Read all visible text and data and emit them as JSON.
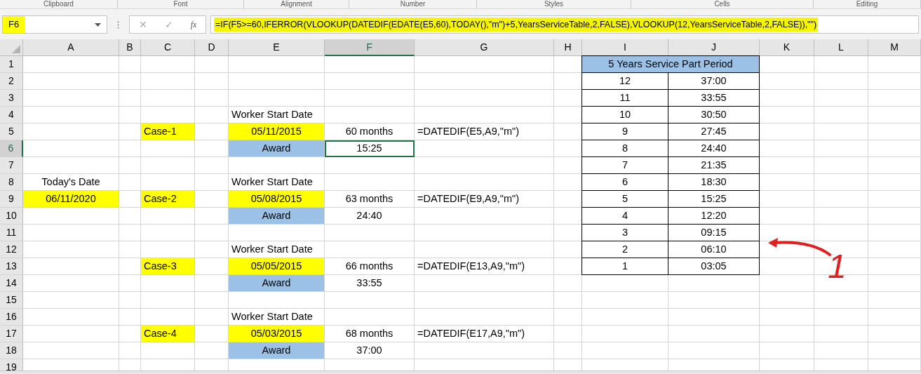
{
  "ribbon_groups": [
    "Clipboard",
    "Font",
    "Alignment",
    "Number",
    "Styles",
    "Cells",
    "Editing"
  ],
  "formula_bar": {
    "name_box": "F6",
    "cancel": "✕",
    "enter": "✓",
    "function": "fx",
    "formula": "=IF(F5>=60,IFERROR(VLOOKUP(DATEDIF(EDATE(E5,60),TODAY(),\"m\")+5,YearsServiceTable,2,FALSE),VLOOKUP(12,YearsServiceTable,2,FALSE)),\"\")"
  },
  "columns": [
    "A",
    "B",
    "C",
    "D",
    "E",
    "F",
    "G",
    "H",
    "I",
    "J",
    "K",
    "L",
    "M"
  ],
  "rows": [
    {
      "number": "1",
      "cells": {
        "I": {
          "text": "5 Years Service Part Period",
          "color": "#9bc2e6",
          "merge": true,
          "bordered": true,
          "selected": false
        }
      }
    },
    {
      "number": "2",
      "cells": {
        "I": {
          "text": "12",
          "bordered": true,
          "selected": false
        },
        "J": {
          "text": "37:00",
          "bordered": true,
          "selected": false
        }
      }
    },
    {
      "number": "3",
      "cells": {
        "I": {
          "text": "11",
          "bordered": true,
          "selected": false
        },
        "J": {
          "text": "33:55",
          "bordered": true,
          "selected": false
        }
      }
    },
    {
      "number": "4",
      "cells": {
        "E": {
          "text": "Worker Start Date",
          "left_aligned": true,
          "selected": false
        },
        "I": {
          "text": "10",
          "bordered": true,
          "selected": false
        },
        "J": {
          "text": "30:50",
          "bordered": true,
          "selected": false
        }
      }
    },
    {
      "number": "5",
      "cells": {
        "C": {
          "text": "Case-1",
          "color": "#ffff00",
          "left_aligned": true,
          "selected": false
        },
        "E": {
          "text": "05/11/2015",
          "color": "#ffff00",
          "selected": false
        },
        "F": {
          "text": "60 months",
          "selected": false
        },
        "G": {
          "text": "=DATEDIF(E5,A9,\"m\")",
          "left_aligned": true,
          "selected": false
        },
        "I": {
          "text": "9",
          "bordered": true,
          "selected": false
        },
        "J": {
          "text": "27:45",
          "bordered": true,
          "selected": false
        }
      }
    },
    {
      "number": "6",
      "cells": {
        "E": {
          "text": "Award",
          "color": "#9bc2e6",
          "selected": false
        },
        "F": {
          "text": "15:25",
          "selected": true
        },
        "I": {
          "text": "8",
          "bordered": true,
          "selected": false
        },
        "J": {
          "text": "24:40",
          "bordered": true,
          "selected": false
        }
      }
    },
    {
      "number": "7",
      "cells": {
        "I": {
          "text": "7",
          "bordered": true,
          "selected": false
        },
        "J": {
          "text": "21:35",
          "bordered": true,
          "selected": false
        }
      }
    },
    {
      "number": "8",
      "cells": {
        "A": {
          "text": "Today's Date",
          "selected": false
        },
        "E": {
          "text": "Worker Start Date",
          "left_aligned": true,
          "selected": false
        },
        "I": {
          "text": "6",
          "bordered": true,
          "selected": false
        },
        "J": {
          "text": "18:30",
          "bordered": true,
          "selected": false
        }
      }
    },
    {
      "number": "9",
      "cells": {
        "A": {
          "text": "06/11/2020",
          "color": "#ffff00",
          "selected": false
        },
        "C": {
          "text": "Case-2",
          "color": "#ffff00",
          "left_aligned": true,
          "selected": false
        },
        "E": {
          "text": "05/08/2015",
          "color": "#ffff00",
          "selected": false
        },
        "F": {
          "text": "63 months",
          "selected": false
        },
        "G": {
          "text": "=DATEDIF(E9,A9,\"m\")",
          "left_aligned": true,
          "selected": false
        },
        "I": {
          "text": "5",
          "bordered": true,
          "selected": false
        },
        "J": {
          "text": "15:25",
          "bordered": true,
          "selected": false
        }
      }
    },
    {
      "number": "10",
      "cells": {
        "E": {
          "text": "Award",
          "color": "#9bc2e6",
          "selected": false
        },
        "F": {
          "text": "24:40",
          "selected": false
        },
        "I": {
          "text": "4",
          "bordered": true,
          "selected": false
        },
        "J": {
          "text": "12:20",
          "bordered": true,
          "selected": false
        }
      }
    },
    {
      "number": "11",
      "cells": {
        "I": {
          "text": "3",
          "bordered": true,
          "selected": false
        },
        "J": {
          "text": "09:15",
          "bordered": true,
          "selected": false
        }
      }
    },
    {
      "number": "12",
      "cells": {
        "E": {
          "text": "Worker Start Date",
          "left_aligned": true,
          "selected": false
        },
        "I": {
          "text": "2",
          "bordered": true,
          "selected": false
        },
        "J": {
          "text": "06:10",
          "bordered": true,
          "selected": false
        }
      }
    },
    {
      "number": "13",
      "cells": {
        "C": {
          "text": "Case-3",
          "color": "#ffff00",
          "left_aligned": true,
          "selected": false
        },
        "E": {
          "text": "05/05/2015",
          "color": "#ffff00",
          "selected": false
        },
        "F": {
          "text": "66 months",
          "selected": false
        },
        "G": {
          "text": "=DATEDIF(E13,A9,\"m\")",
          "left_aligned": true,
          "selected": false
        },
        "I": {
          "text": "1",
          "bordered": true,
          "selected": false
        },
        "J": {
          "text": "03:05",
          "bordered": true,
          "selected": false
        }
      }
    },
    {
      "number": "14",
      "cells": {
        "E": {
          "text": "Award",
          "color": "#9bc2e6",
          "selected": false
        },
        "F": {
          "text": "33:55",
          "selected": false
        }
      }
    },
    {
      "number": "15",
      "cells": {}
    },
    {
      "number": "16",
      "cells": {
        "E": {
          "text": "Worker Start Date",
          "left_aligned": true,
          "selected": false
        }
      }
    },
    {
      "number": "17",
      "cells": {
        "C": {
          "text": "Case-4",
          "color": "#ffff00",
          "left_aligned": true,
          "selected": false
        },
        "E": {
          "text": "05/03/2015",
          "color": "#ffff00",
          "selected": false
        },
        "F": {
          "text": "68 months",
          "selected": false
        },
        "G": {
          "text": "=DATEDIF(E17,A9,\"m\")",
          "left_aligned": true,
          "selected": false
        }
      }
    },
    {
      "number": "18",
      "cells": {
        "E": {
          "text": "Award",
          "color": "#9bc2e6",
          "selected": false
        },
        "F": {
          "text": "37:00",
          "selected": false
        }
      }
    },
    {
      "number": "19",
      "cells": {}
    }
  ],
  "annotation": {
    "text": "1"
  }
}
